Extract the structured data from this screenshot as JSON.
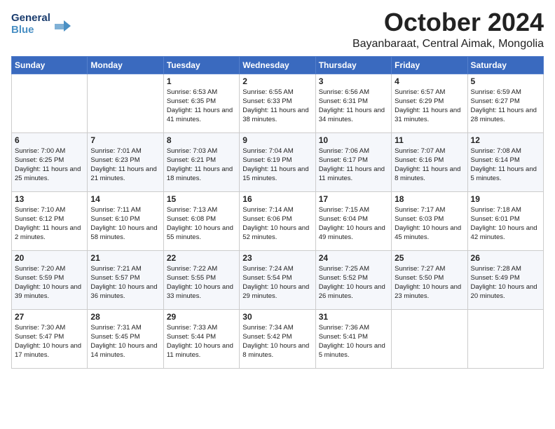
{
  "header": {
    "logo_line1": "General",
    "logo_line2": "Blue",
    "month": "October 2024",
    "location": "Bayanbaraat, Central Aimak, Mongolia"
  },
  "days_of_week": [
    "Sunday",
    "Monday",
    "Tuesday",
    "Wednesday",
    "Thursday",
    "Friday",
    "Saturday"
  ],
  "weeks": [
    [
      {
        "day": "",
        "sunrise": "",
        "sunset": "",
        "daylight": ""
      },
      {
        "day": "",
        "sunrise": "",
        "sunset": "",
        "daylight": ""
      },
      {
        "day": "1",
        "sunrise": "Sunrise: 6:53 AM",
        "sunset": "Sunset: 6:35 PM",
        "daylight": "Daylight: 11 hours and 41 minutes."
      },
      {
        "day": "2",
        "sunrise": "Sunrise: 6:55 AM",
        "sunset": "Sunset: 6:33 PM",
        "daylight": "Daylight: 11 hours and 38 minutes."
      },
      {
        "day": "3",
        "sunrise": "Sunrise: 6:56 AM",
        "sunset": "Sunset: 6:31 PM",
        "daylight": "Daylight: 11 hours and 34 minutes."
      },
      {
        "day": "4",
        "sunrise": "Sunrise: 6:57 AM",
        "sunset": "Sunset: 6:29 PM",
        "daylight": "Daylight: 11 hours and 31 minutes."
      },
      {
        "day": "5",
        "sunrise": "Sunrise: 6:59 AM",
        "sunset": "Sunset: 6:27 PM",
        "daylight": "Daylight: 11 hours and 28 minutes."
      }
    ],
    [
      {
        "day": "6",
        "sunrise": "Sunrise: 7:00 AM",
        "sunset": "Sunset: 6:25 PM",
        "daylight": "Daylight: 11 hours and 25 minutes."
      },
      {
        "day": "7",
        "sunrise": "Sunrise: 7:01 AM",
        "sunset": "Sunset: 6:23 PM",
        "daylight": "Daylight: 11 hours and 21 minutes."
      },
      {
        "day": "8",
        "sunrise": "Sunrise: 7:03 AM",
        "sunset": "Sunset: 6:21 PM",
        "daylight": "Daylight: 11 hours and 18 minutes."
      },
      {
        "day": "9",
        "sunrise": "Sunrise: 7:04 AM",
        "sunset": "Sunset: 6:19 PM",
        "daylight": "Daylight: 11 hours and 15 minutes."
      },
      {
        "day": "10",
        "sunrise": "Sunrise: 7:06 AM",
        "sunset": "Sunset: 6:17 PM",
        "daylight": "Daylight: 11 hours and 11 minutes."
      },
      {
        "day": "11",
        "sunrise": "Sunrise: 7:07 AM",
        "sunset": "Sunset: 6:16 PM",
        "daylight": "Daylight: 11 hours and 8 minutes."
      },
      {
        "day": "12",
        "sunrise": "Sunrise: 7:08 AM",
        "sunset": "Sunset: 6:14 PM",
        "daylight": "Daylight: 11 hours and 5 minutes."
      }
    ],
    [
      {
        "day": "13",
        "sunrise": "Sunrise: 7:10 AM",
        "sunset": "Sunset: 6:12 PM",
        "daylight": "Daylight: 11 hours and 2 minutes."
      },
      {
        "day": "14",
        "sunrise": "Sunrise: 7:11 AM",
        "sunset": "Sunset: 6:10 PM",
        "daylight": "Daylight: 10 hours and 58 minutes."
      },
      {
        "day": "15",
        "sunrise": "Sunrise: 7:13 AM",
        "sunset": "Sunset: 6:08 PM",
        "daylight": "Daylight: 10 hours and 55 minutes."
      },
      {
        "day": "16",
        "sunrise": "Sunrise: 7:14 AM",
        "sunset": "Sunset: 6:06 PM",
        "daylight": "Daylight: 10 hours and 52 minutes."
      },
      {
        "day": "17",
        "sunrise": "Sunrise: 7:15 AM",
        "sunset": "Sunset: 6:04 PM",
        "daylight": "Daylight: 10 hours and 49 minutes."
      },
      {
        "day": "18",
        "sunrise": "Sunrise: 7:17 AM",
        "sunset": "Sunset: 6:03 PM",
        "daylight": "Daylight: 10 hours and 45 minutes."
      },
      {
        "day": "19",
        "sunrise": "Sunrise: 7:18 AM",
        "sunset": "Sunset: 6:01 PM",
        "daylight": "Daylight: 10 hours and 42 minutes."
      }
    ],
    [
      {
        "day": "20",
        "sunrise": "Sunrise: 7:20 AM",
        "sunset": "Sunset: 5:59 PM",
        "daylight": "Daylight: 10 hours and 39 minutes."
      },
      {
        "day": "21",
        "sunrise": "Sunrise: 7:21 AM",
        "sunset": "Sunset: 5:57 PM",
        "daylight": "Daylight: 10 hours and 36 minutes."
      },
      {
        "day": "22",
        "sunrise": "Sunrise: 7:22 AM",
        "sunset": "Sunset: 5:55 PM",
        "daylight": "Daylight: 10 hours and 33 minutes."
      },
      {
        "day": "23",
        "sunrise": "Sunrise: 7:24 AM",
        "sunset": "Sunset: 5:54 PM",
        "daylight": "Daylight: 10 hours and 29 minutes."
      },
      {
        "day": "24",
        "sunrise": "Sunrise: 7:25 AM",
        "sunset": "Sunset: 5:52 PM",
        "daylight": "Daylight: 10 hours and 26 minutes."
      },
      {
        "day": "25",
        "sunrise": "Sunrise: 7:27 AM",
        "sunset": "Sunset: 5:50 PM",
        "daylight": "Daylight: 10 hours and 23 minutes."
      },
      {
        "day": "26",
        "sunrise": "Sunrise: 7:28 AM",
        "sunset": "Sunset: 5:49 PM",
        "daylight": "Daylight: 10 hours and 20 minutes."
      }
    ],
    [
      {
        "day": "27",
        "sunrise": "Sunrise: 7:30 AM",
        "sunset": "Sunset: 5:47 PM",
        "daylight": "Daylight: 10 hours and 17 minutes."
      },
      {
        "day": "28",
        "sunrise": "Sunrise: 7:31 AM",
        "sunset": "Sunset: 5:45 PM",
        "daylight": "Daylight: 10 hours and 14 minutes."
      },
      {
        "day": "29",
        "sunrise": "Sunrise: 7:33 AM",
        "sunset": "Sunset: 5:44 PM",
        "daylight": "Daylight: 10 hours and 11 minutes."
      },
      {
        "day": "30",
        "sunrise": "Sunrise: 7:34 AM",
        "sunset": "Sunset: 5:42 PM",
        "daylight": "Daylight: 10 hours and 8 minutes."
      },
      {
        "day": "31",
        "sunrise": "Sunrise: 7:36 AM",
        "sunset": "Sunset: 5:41 PM",
        "daylight": "Daylight: 10 hours and 5 minutes."
      },
      {
        "day": "",
        "sunrise": "",
        "sunset": "",
        "daylight": ""
      },
      {
        "day": "",
        "sunrise": "",
        "sunset": "",
        "daylight": ""
      }
    ]
  ]
}
